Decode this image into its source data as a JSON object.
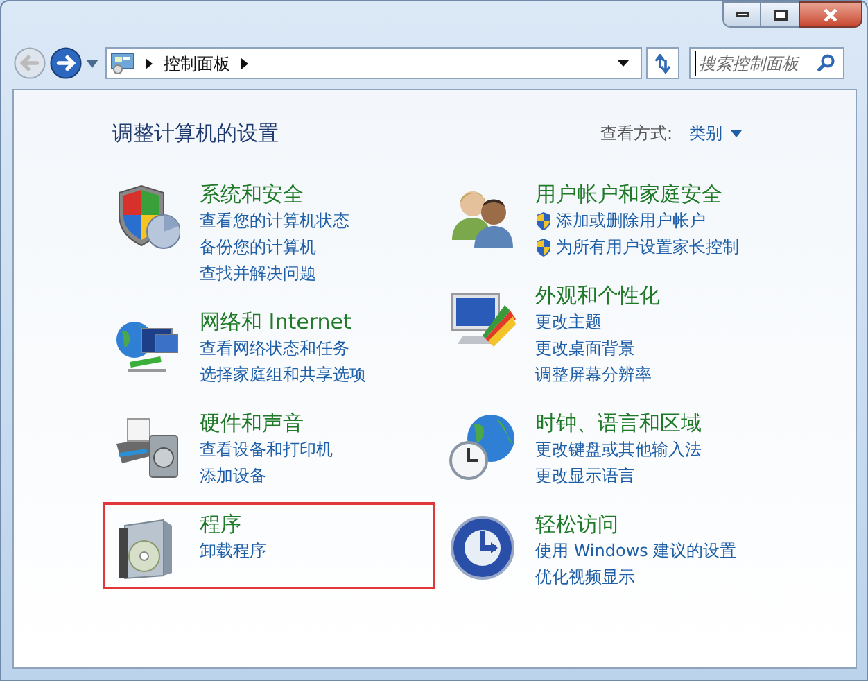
{
  "nav": {
    "back_enabled": false,
    "forward_enabled": true
  },
  "address": {
    "crumbs": [
      "控制面板"
    ]
  },
  "search": {
    "placeholder": "搜索控制面板"
  },
  "heading": "调整计算机的设置",
  "view": {
    "label": "查看方式:",
    "value": "类别"
  },
  "columns": [
    [
      {
        "title": "系统和安全",
        "highlighted": false,
        "links": [
          {
            "text": "查看您的计算机状态",
            "shield": false
          },
          {
            "text": "备份您的计算机",
            "shield": false
          },
          {
            "text": "查找并解决问题",
            "shield": false
          }
        ]
      },
      {
        "title": "网络和 Internet",
        "highlighted": false,
        "links": [
          {
            "text": "查看网络状态和任务",
            "shield": false
          },
          {
            "text": "选择家庭组和共享选项",
            "shield": false
          }
        ]
      },
      {
        "title": "硬件和声音",
        "highlighted": false,
        "links": [
          {
            "text": "查看设备和打印机",
            "shield": false
          },
          {
            "text": "添加设备",
            "shield": false
          }
        ]
      },
      {
        "title": "程序",
        "highlighted": true,
        "links": [
          {
            "text": "卸载程序",
            "shield": false
          }
        ]
      }
    ],
    [
      {
        "title": "用户帐户和家庭安全",
        "highlighted": false,
        "links": [
          {
            "text": "添加或删除用户帐户",
            "shield": true
          },
          {
            "text": "为所有用户设置家长控制",
            "shield": true
          }
        ]
      },
      {
        "title": "外观和个性化",
        "highlighted": false,
        "links": [
          {
            "text": "更改主题",
            "shield": false
          },
          {
            "text": "更改桌面背景",
            "shield": false
          },
          {
            "text": "调整屏幕分辨率",
            "shield": false
          }
        ]
      },
      {
        "title": "时钟、语言和区域",
        "highlighted": false,
        "links": [
          {
            "text": "更改键盘或其他输入法",
            "shield": false
          },
          {
            "text": "更改显示语言",
            "shield": false
          }
        ]
      },
      {
        "title": "轻松访问",
        "highlighted": false,
        "links": [
          {
            "text": "使用 Windows 建议的设置",
            "shield": false
          },
          {
            "text": "优化视频显示",
            "shield": false
          }
        ]
      }
    ]
  ]
}
